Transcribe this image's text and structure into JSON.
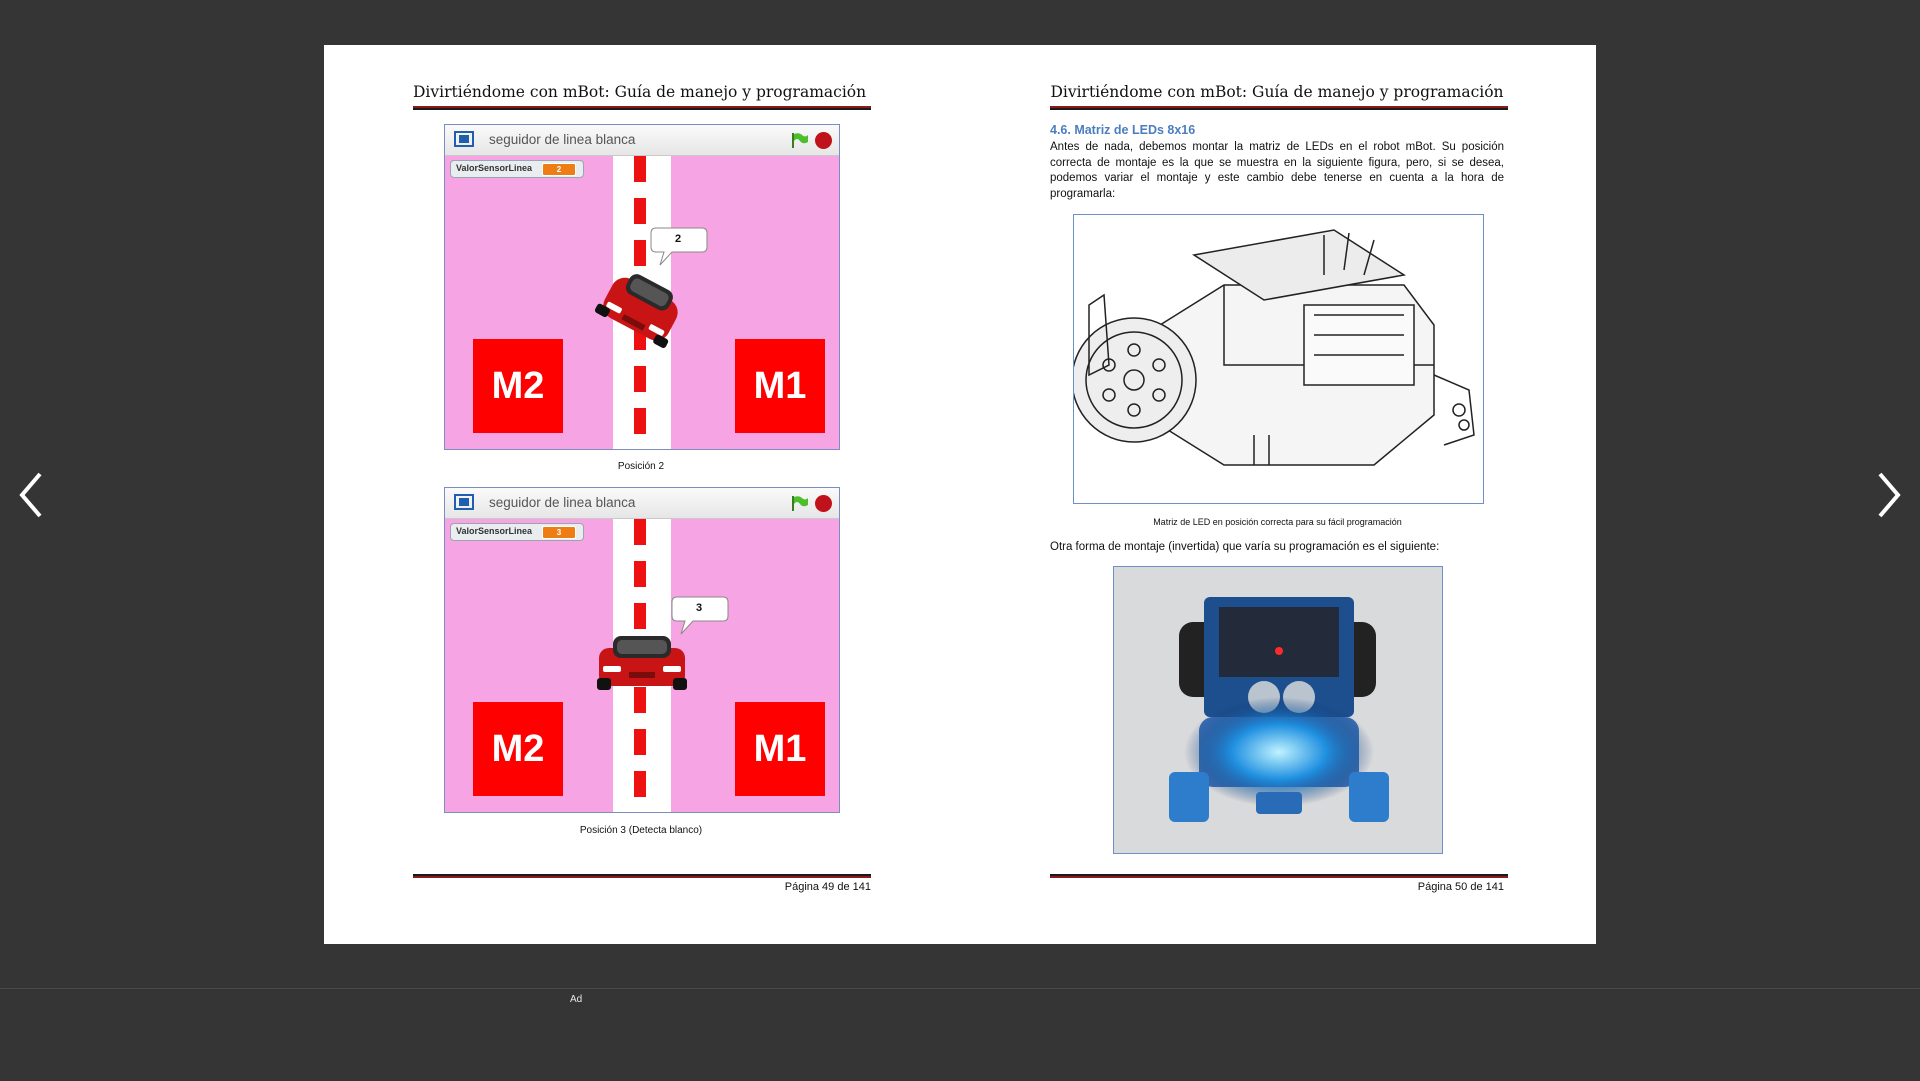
{
  "viewer": {
    "prev_label": "",
    "next_label": "",
    "ad_label": "Ad"
  },
  "left_page": {
    "header": "Divirtiéndome con mBot: Guía de manejo y programación",
    "footer": "Página 49 de 141",
    "stages": [
      {
        "title": "seguidor de linea blanca",
        "variable_name": "ValorSensorLinea",
        "variable_value": "2",
        "bubble_text": "2",
        "box_left": "M2",
        "box_right": "M1",
        "caption": "Posición 2"
      },
      {
        "title": "seguidor de linea blanca",
        "variable_name": "ValorSensorLinea",
        "variable_value": "3",
        "bubble_text": "3",
        "box_left": "M2",
        "box_right": "M1",
        "caption": "Posición 3 (Detecta blanco)"
      }
    ]
  },
  "right_page": {
    "header": "Divirtiéndome con mBot: Guía de manejo y programación",
    "footer": "Página 50 de 141",
    "section_title": "4.6. Matriz de LEDs 8x16",
    "paragraph": "Antes de nada, debemos montar la matriz de LEDs en el robot mBot. Su posición correcta de montaje es la que se muestra en la siguiente figura, pero, si se desea, podemos variar el montaje y este cambio debe tenerse en cuenta a la hora de programarla:",
    "figure1_caption": "Matriz de LED en posición correcta para su fácil programación",
    "paragraph2": "Otra forma de montaje (invertida) que varía su programación es el siguiente:"
  },
  "colors": {
    "background": "#353535",
    "stage_pink": "#f7a4e4",
    "motor_red": "#ff0000",
    "section_blue": "#4a7ebf",
    "rule_red": "#8b1a1a"
  },
  "icons": [
    "chevron-left-icon",
    "chevron-right-icon",
    "fullscreen-icon",
    "green-flag-icon",
    "stop-icon"
  ]
}
